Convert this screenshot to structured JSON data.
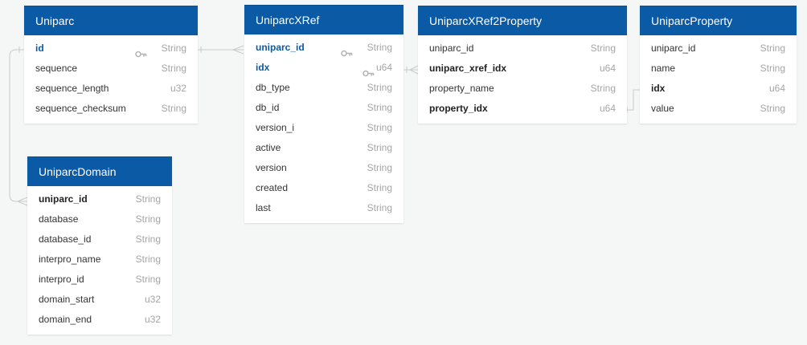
{
  "colors": {
    "header": "#0a5aa5",
    "background": "#f5f6f6",
    "connector": "#c8cbcd",
    "primary_key_text": "#0a5aa5"
  },
  "tables": [
    {
      "id": "uniparc",
      "name": "Uniparc",
      "fields": [
        {
          "name": "id",
          "type": "String",
          "style": "pk",
          "key": true
        },
        {
          "name": "sequence",
          "type": "String"
        },
        {
          "name": "sequence_length",
          "type": "u32"
        },
        {
          "name": "sequence_checksum",
          "type": "String"
        }
      ]
    },
    {
      "id": "uniparc-xref",
      "name": "UniparcXRef",
      "fields": [
        {
          "name": "uniparc_id",
          "type": "String",
          "style": "pk",
          "key": true
        },
        {
          "name": "idx",
          "type": "u64",
          "style": "pk",
          "key": true
        },
        {
          "name": "db_type",
          "type": "String"
        },
        {
          "name": "db_id",
          "type": "String"
        },
        {
          "name": "version_i",
          "type": "String"
        },
        {
          "name": "active",
          "type": "String"
        },
        {
          "name": "version",
          "type": "String"
        },
        {
          "name": "created",
          "type": "String"
        },
        {
          "name": "last",
          "type": "String"
        }
      ]
    },
    {
      "id": "uniparc-xref2property",
      "name": "UniparcXRef2Property",
      "fields": [
        {
          "name": "uniparc_id",
          "type": "String"
        },
        {
          "name": "uniparc_xref_idx",
          "type": "u64",
          "style": "bold"
        },
        {
          "name": "property_name",
          "type": "String"
        },
        {
          "name": "property_idx",
          "type": "u64",
          "style": "bold"
        }
      ]
    },
    {
      "id": "uniparc-property",
      "name": "UniparcProperty",
      "fields": [
        {
          "name": "uniparc_id",
          "type": "String"
        },
        {
          "name": "name",
          "type": "String"
        },
        {
          "name": "idx",
          "type": "u64",
          "style": "bold"
        },
        {
          "name": "value",
          "type": "String"
        }
      ]
    },
    {
      "id": "uniparc-domain",
      "name": "UniparcDomain",
      "fields": [
        {
          "name": "uniparc_id",
          "type": "String",
          "style": "bold"
        },
        {
          "name": "database",
          "type": "String"
        },
        {
          "name": "database_id",
          "type": "String"
        },
        {
          "name": "interpro_name",
          "type": "String"
        },
        {
          "name": "interpro_id",
          "type": "String"
        },
        {
          "name": "domain_start",
          "type": "u32"
        },
        {
          "name": "domain_end",
          "type": "u32"
        }
      ]
    }
  ]
}
